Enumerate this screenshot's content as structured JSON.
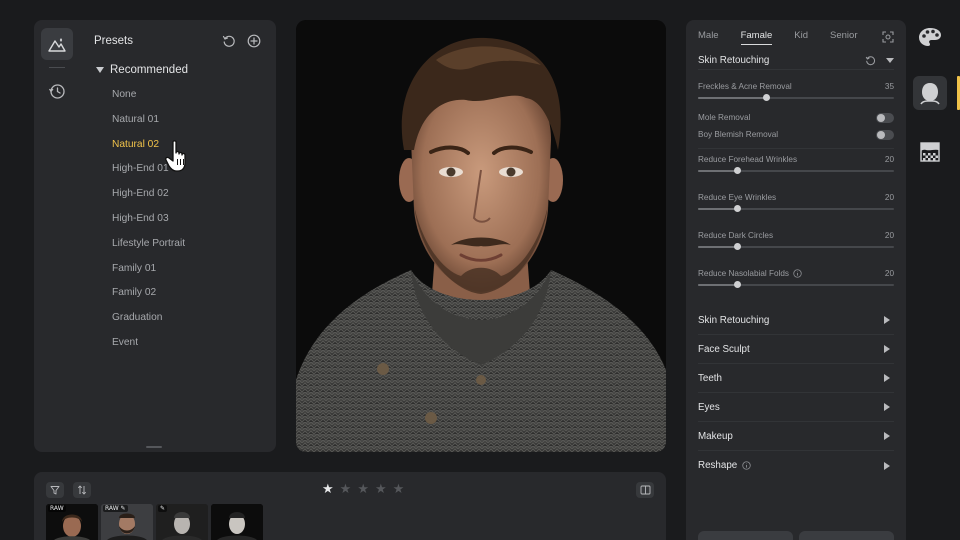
{
  "left_panel": {
    "title": "Presets",
    "group": "Recommended",
    "presets": [
      "None",
      "Natural 01",
      "Natural 02",
      "High-End 01",
      "High-End 02",
      "High-End 03",
      "Lifestyle Portrait",
      "Family 01",
      "Family 02",
      "Graduation",
      "Event"
    ],
    "active_preset": "Natural 02"
  },
  "right_panel": {
    "tabs": [
      "Male",
      "Famale",
      "Kid",
      "Senior"
    ],
    "active_tab": "Famale",
    "section_title": "Skin Retouching",
    "sliders": [
      {
        "label": "Freckles & Acne Removal",
        "value": 35
      },
      {
        "label": "Reduce Forehead Wrinkles",
        "value": 20
      },
      {
        "label": "Reduce Eye Wrinkles",
        "value": 20
      },
      {
        "label": "Reduce Dark Circles",
        "value": 20
      },
      {
        "label": "Reduce Nasolabial Folds",
        "value": 20
      }
    ],
    "toggles": [
      {
        "label": "Mole Removal",
        "on": false
      },
      {
        "label": "Boy Blemish Removal",
        "on": false
      }
    ],
    "categories": [
      "Skin Retouching",
      "Face Sculpt",
      "Teeth",
      "Eyes",
      "Makeup",
      "Reshape"
    ]
  },
  "filmstrip": {
    "rating": 1,
    "max_rating": 5,
    "thumbnails": [
      {
        "tag": "RAW"
      },
      {
        "tag": "RAW ✎"
      },
      {
        "tag": "✎"
      },
      {
        "tag": ""
      }
    ]
  },
  "colors": {
    "accent": "#f1c34a",
    "panel": "#28292c",
    "background": "#1a1b1d"
  }
}
